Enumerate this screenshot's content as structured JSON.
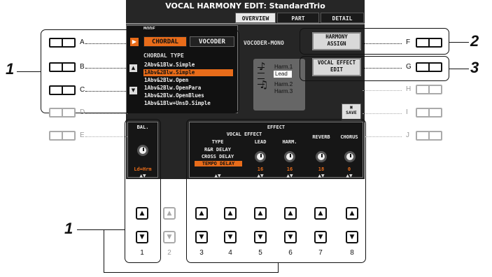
{
  "screen": {
    "title": "VOCAL HARMONY EDIT: StandardTrio",
    "tabs": [
      {
        "label": "OVERVIEW",
        "active": true
      },
      {
        "label": "PART",
        "active": false
      },
      {
        "label": "DETAIL",
        "active": false
      }
    ],
    "mode": {
      "label": "MODE",
      "options": [
        "CHORDAL",
        "VOCODER"
      ],
      "selected": "CHORDAL"
    },
    "chordal_type": {
      "label": "CHORDAL TYPE",
      "items": [
        "2Abv&1Blw.Simple",
        "1Abv&2Blw.Simple",
        "1Abv&2Blw.Open",
        "1Abv&2Blw.OpenPara",
        "1Abv&2Blw.OpenBlues",
        "1Abv&1Blw+UnsD.Simple"
      ],
      "selected_index": 1
    },
    "vocoder_mono": "VOCODER-MONO",
    "staff_labels": [
      "Harm.1",
      "Lead",
      "Harm.2",
      "Harm.3"
    ],
    "harmony_assign": [
      "HARMONY",
      "ASSIGN"
    ],
    "vocal_effect_edit": [
      "VOCAL EFFECT",
      "EDIT"
    ],
    "save_label": "SAVE",
    "balance": {
      "label": "BAL.",
      "value": "Ld=Hrm"
    },
    "effect": {
      "label": "EFFECT",
      "vocal_effect_label": "VOCAL EFFECT",
      "type_label": "TYPE",
      "types": [
        "R&R DELAY",
        "CROSS DELAY",
        "TEMPO DELAY"
      ],
      "selected_type_index": 2,
      "lead_label": "LEAD",
      "lead_value": "16",
      "harm_label": "HARM.",
      "harm_value": "16",
      "reverb_label": "REVERB",
      "reverb_value": "18",
      "chorus_label": "CHORUS",
      "chorus_value": "0"
    },
    "dial_arrows": "▲▼"
  },
  "left_buttons": [
    "A",
    "B",
    "C",
    "D",
    "E"
  ],
  "right_buttons": [
    "F",
    "G",
    "H",
    "I",
    "J"
  ],
  "column_numbers": [
    "1",
    "2",
    "3",
    "4",
    "5",
    "6",
    "7",
    "8"
  ],
  "callouts": {
    "one_top": "1",
    "one_bottom": "1",
    "two": "2",
    "three": "3"
  },
  "arrows": {
    "up": "▲",
    "down": "▼",
    "play": "▶"
  }
}
